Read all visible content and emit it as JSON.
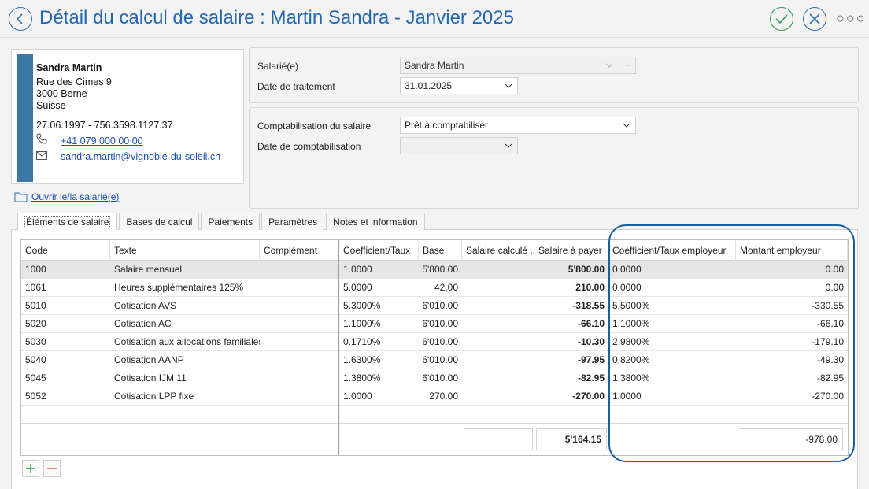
{
  "header": {
    "title": "Détail du calcul de salaire : Martin Sandra - Janvier 2025",
    "more_label": "○○○"
  },
  "employee_card": {
    "name": "Sandra Martin",
    "street": "Rue des Cimes 9",
    "city": "3000 Berne",
    "country": "Suisse",
    "birth_avs": "27.06.1997 - 756.3598.1127.37",
    "phone": "+41 079 000 00 00",
    "email": "sandra.martin@vignoble-du-soleil.ch",
    "open_link": "Ouvrir le/la salarié(e)"
  },
  "form": {
    "employee_label": "Salarié(e)",
    "employee_value": "Sandra Martin",
    "processing_date_label": "Date de traitement",
    "processing_date_value": "31.01.2025",
    "accounting_label": "Comptabilisation du salaire",
    "accounting_value": "Prêt à comptabiliser",
    "accounting_date_label": "Date de comptabilisation",
    "accounting_date_value": ""
  },
  "tabs": [
    {
      "label": "Éléments de salaire",
      "active": true
    },
    {
      "label": "Bases de calcul",
      "active": false
    },
    {
      "label": "Paiements",
      "active": false
    },
    {
      "label": "Paramètres",
      "active": false
    },
    {
      "label": "Notes et information",
      "active": false
    }
  ],
  "table": {
    "columns": [
      "Code",
      "Texte",
      "Complément",
      "Coefficient/Taux",
      "Base",
      "Salaire calculé ...",
      "Salaire à payer",
      "Coefficient/Taux employeur",
      "Montant employeur"
    ],
    "rows": [
      {
        "code": "1000",
        "text": "Salaire mensuel",
        "complement": "",
        "coef": "1.0000",
        "base": "5'800.00",
        "calc": "",
        "pay": "5'800.00",
        "emp_coef": "0.0000",
        "emp_amount": "0.00"
      },
      {
        "code": "1061",
        "text": "Heures supplémentaires 125%",
        "complement": "",
        "coef": "5.0000",
        "base": "42.00",
        "calc": "",
        "pay": "210.00",
        "emp_coef": "0.0000",
        "emp_amount": "0.00"
      },
      {
        "code": "5010",
        "text": "Cotisation AVS",
        "complement": "",
        "coef": "5.3000%",
        "base": "6'010.00",
        "calc": "",
        "pay": "-318.55",
        "emp_coef": "5.5000%",
        "emp_amount": "-330.55"
      },
      {
        "code": "5020",
        "text": "Cotisation AC",
        "complement": "",
        "coef": "1.1000%",
        "base": "6'010.00",
        "calc": "",
        "pay": "-66.10",
        "emp_coef": "1.1000%",
        "emp_amount": "-66.10"
      },
      {
        "code": "5030",
        "text": "Cotisation aux allocations familiales",
        "complement": "",
        "coef": "0.1710%",
        "base": "6'010.00",
        "calc": "",
        "pay": "-10.30",
        "emp_coef": "2.9800%",
        "emp_amount": "-179.10"
      },
      {
        "code": "5040",
        "text": "Cotisation AANP",
        "complement": "",
        "coef": "1.6300%",
        "base": "6'010.00",
        "calc": "",
        "pay": "-97.95",
        "emp_coef": "0.8200%",
        "emp_amount": "-49.30"
      },
      {
        "code": "5045",
        "text": "Cotisation IJM 11",
        "complement": "",
        "coef": "1.3800%",
        "base": "6'010.00",
        "calc": "",
        "pay": "-82.95",
        "emp_coef": "1.3800%",
        "emp_amount": "-82.95"
      },
      {
        "code": "5052",
        "text": "Cotisation LPP fixe",
        "complement": "",
        "coef": "1.0000",
        "base": "270.00",
        "calc": "",
        "pay": "-270.00",
        "emp_coef": "1.0000",
        "emp_amount": "-270.00"
      }
    ],
    "totals": {
      "calc": "",
      "pay": "5'164.15",
      "emp_amount": "-978.00"
    }
  },
  "colors": {
    "title": "#2367b0",
    "accent": "#1c5fa0",
    "stripe": "#3d77a8",
    "confirm": "#2d9a4e"
  }
}
